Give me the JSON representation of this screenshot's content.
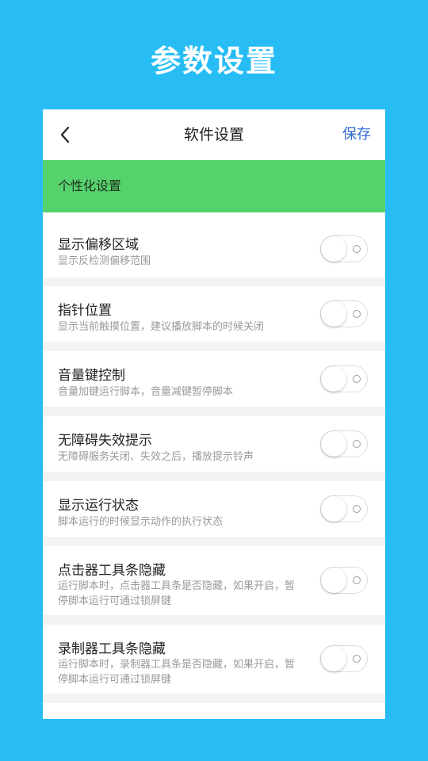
{
  "page_title": "参数设置",
  "topbar": {
    "title": "软件设置",
    "save_label": "保存"
  },
  "section_label": "个性化设置",
  "settings": [
    {
      "title": "显示偏移区域",
      "desc": "显示反检测偏移范围",
      "enabled": false
    },
    {
      "title": "指针位置",
      "desc": "显示当前触摸位置，建议播放脚本的时候关闭",
      "enabled": false
    },
    {
      "title": "音量键控制",
      "desc": "音量加键运行脚本，音量减键暂停脚本",
      "enabled": false
    },
    {
      "title": "无障碍失效提示",
      "desc": "无障碍服务关闭、失效之后，播放提示铃声",
      "enabled": false
    },
    {
      "title": "显示运行状态",
      "desc": "脚本运行的时候显示动作的执行状态",
      "enabled": false
    },
    {
      "title": "点击器工具条隐藏",
      "desc": "运行脚本时，点击器工具条是否隐藏，如果开启，暂停脚本运行可通过锁屏键",
      "enabled": false
    },
    {
      "title": "录制器工具条隐藏",
      "desc": "运行脚本时，录制器工具条是否隐藏，如果开启，暂停脚本运行可通过锁屏键",
      "enabled": false
    }
  ],
  "colors": {
    "background": "#27bdf4",
    "section": "#56d26c",
    "accent": "#2e6bd1"
  },
  "icons": {
    "back": "chevron-left-icon"
  }
}
